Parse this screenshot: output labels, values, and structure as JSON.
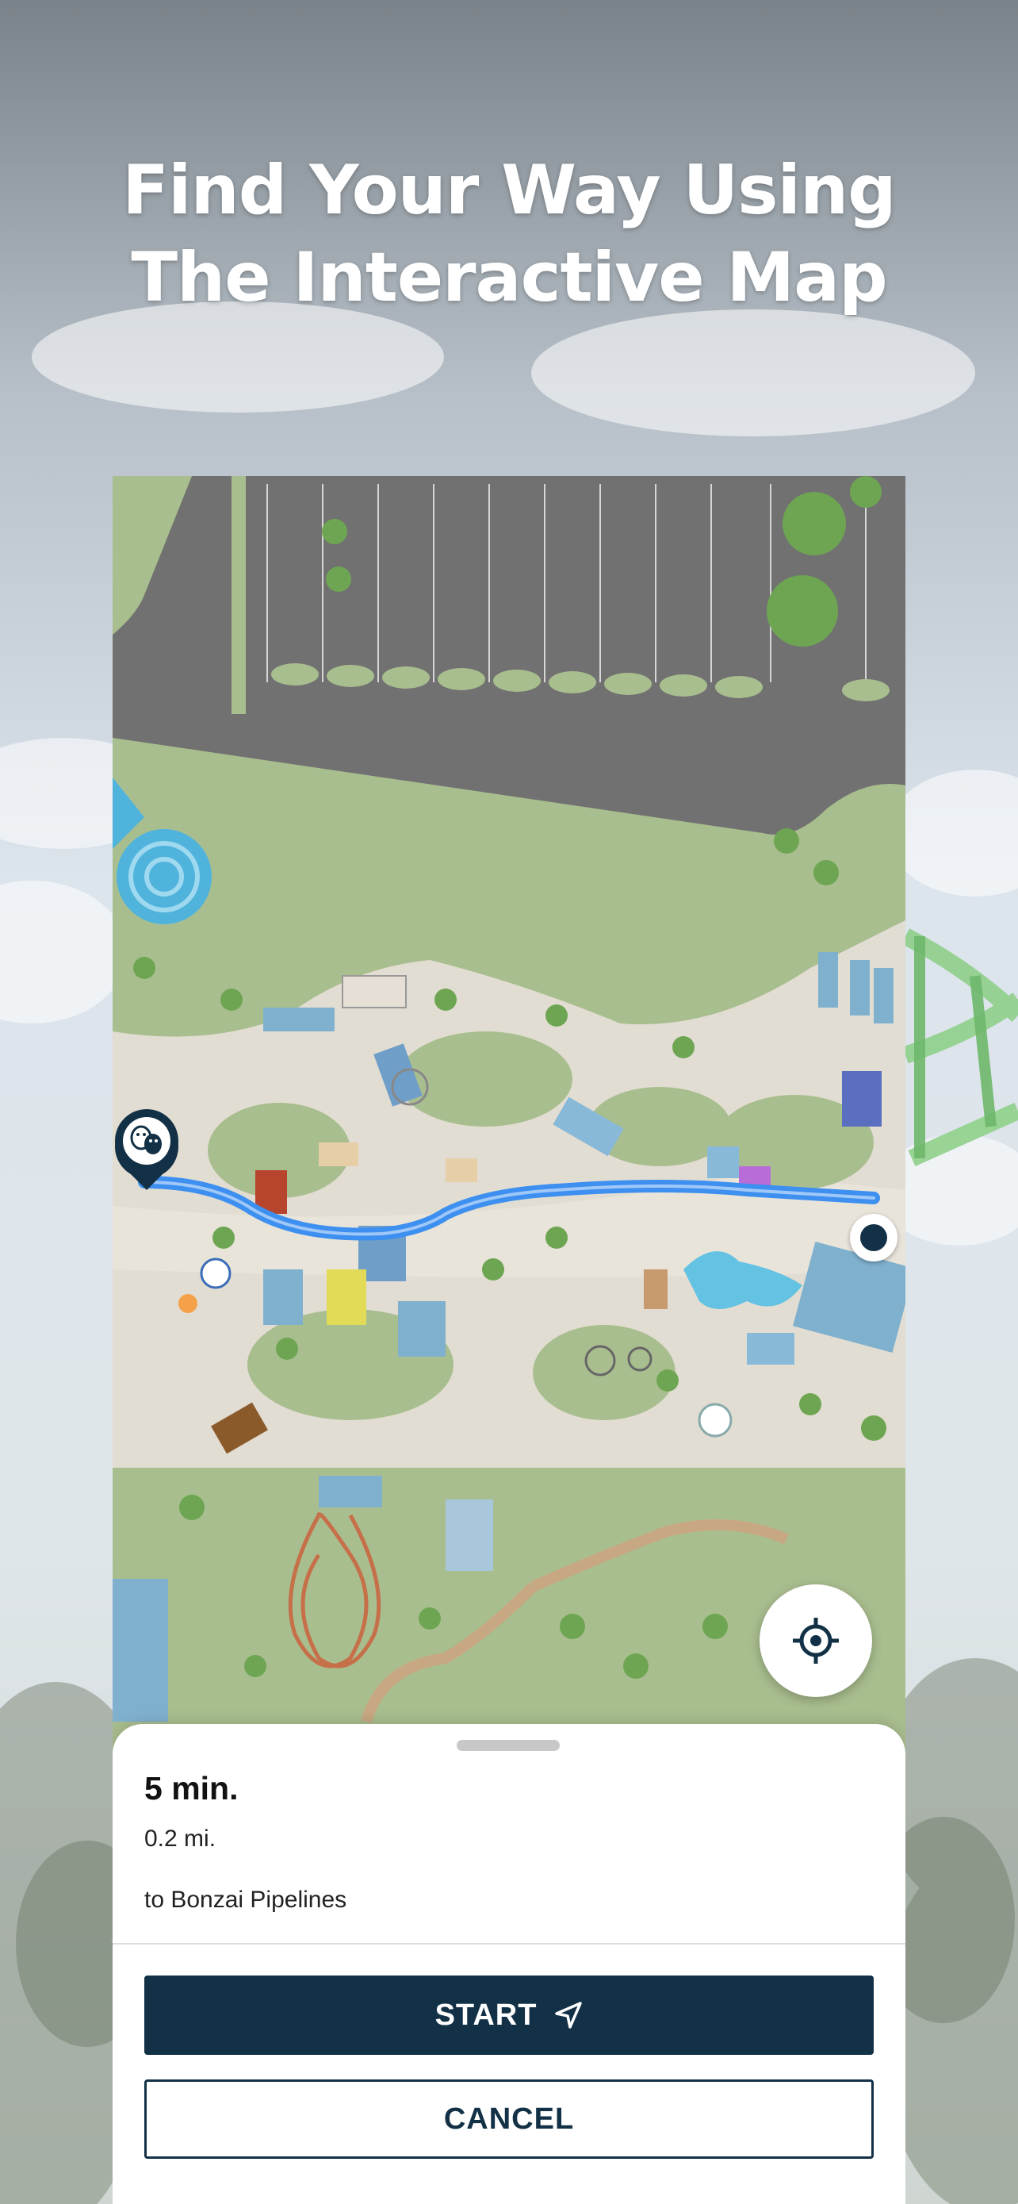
{
  "headline": {
    "line1": "Find Your Way Using",
    "line2": "The Interactive Map"
  },
  "map": {
    "route_color": "#3d8ff0",
    "destination_marker_icon": "theater-masks-icon",
    "current_location_icon": "location-dot-icon"
  },
  "locate_button": {
    "icon": "crosshair-icon"
  },
  "route_sheet": {
    "duration": "5 min.",
    "distance": "0.2 mi.",
    "destination": "to Bonzai Pipelines",
    "start_label": "START",
    "start_icon": "navigation-arrow-icon",
    "cancel_label": "CANCEL"
  },
  "colors": {
    "primary": "#133146",
    "grass": "#a9be8f",
    "path": "#e2ddd2",
    "parking": "#717171"
  }
}
